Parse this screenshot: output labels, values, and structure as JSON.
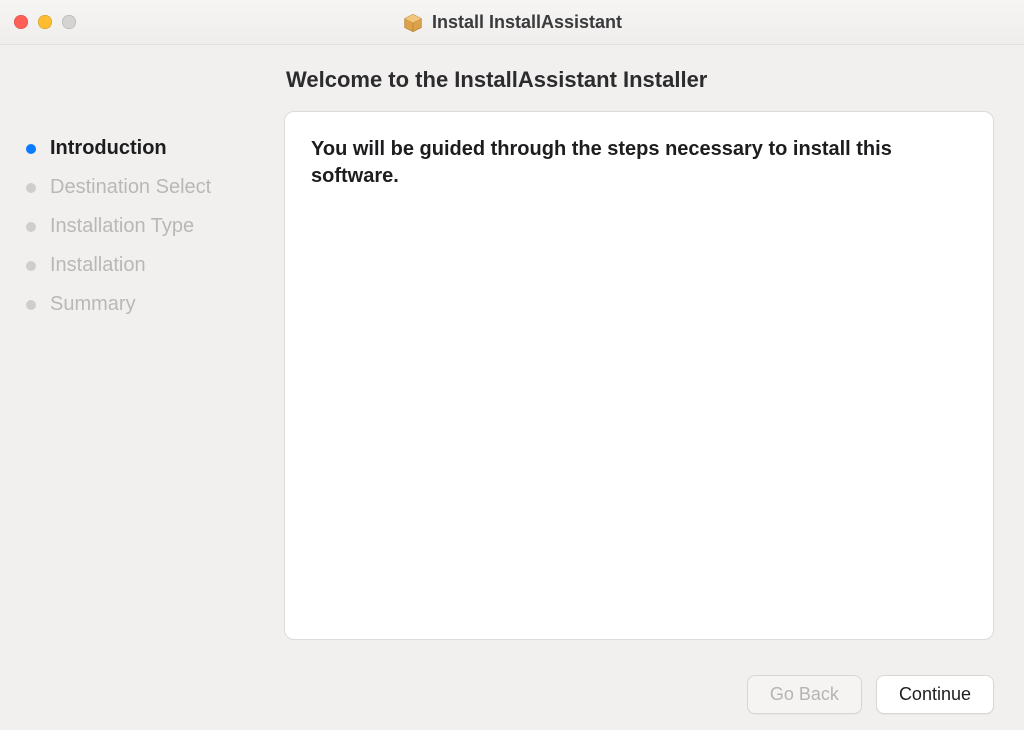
{
  "titlebar": {
    "title": "Install InstallAssistant"
  },
  "sidebar": {
    "steps": [
      {
        "label": "Introduction",
        "active": true
      },
      {
        "label": "Destination Select",
        "active": false
      },
      {
        "label": "Installation Type",
        "active": false
      },
      {
        "label": "Installation",
        "active": false
      },
      {
        "label": "Summary",
        "active": false
      }
    ]
  },
  "main": {
    "heading": "Welcome to the InstallAssistant Installer",
    "body_text": "You will be guided through the steps necessary to install this software."
  },
  "footer": {
    "go_back_label": "Go Back",
    "continue_label": "Continue",
    "go_back_enabled": false,
    "continue_enabled": true
  }
}
